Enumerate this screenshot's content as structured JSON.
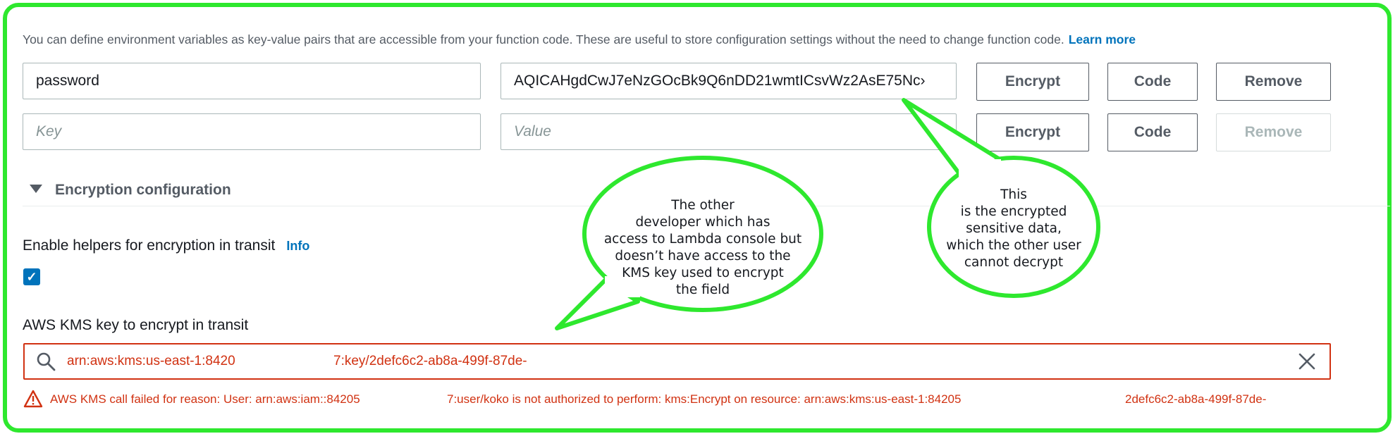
{
  "intro": {
    "text": "You can define environment variables as key-value pairs that are accessible from your function code. These are useful to store configuration settings without the need to change function code.",
    "learn_more": "Learn more"
  },
  "env_rows": [
    {
      "key": "password",
      "value": "AQICAHgdCwJ7eNzGOcBk9Q6nDD21wmtICsvWz2AsE75Nc›",
      "encrypt": "Encrypt",
      "code": "Code",
      "remove": "Remove"
    },
    {
      "key_placeholder": "Key",
      "value_placeholder": "Value",
      "encrypt": "Encrypt",
      "code": "Code",
      "remove": "Remove"
    }
  ],
  "encryption_config": {
    "title": "Encryption configuration",
    "helpers_label": "Enable helpers for encryption in transit",
    "info": "Info",
    "helpers_checked": true,
    "kms_label": "AWS KMS key to encrypt in transit",
    "kms_value_part1": "arn:aws:kms:us-east-1:8420",
    "kms_value_part2": "7:key/2defc6c2-ab8a-499f-87de-",
    "error_part1": "AWS KMS call failed for reason: User: arn:aws:iam::84205",
    "error_part2": "7:user/koko is not authorized to perform: kms:Encrypt on resource: arn:aws:kms:us-east-1:84205",
    "error_part3": "2defc6c2-ab8a-499f-87de-"
  },
  "callouts": {
    "left": [
      "The other",
      "developer which has",
      "access to Lambda console but",
      "doesn’t have access to the",
      "KMS key used to encrypt",
      "the field"
    ],
    "right": [
      "This",
      "is the encrypted",
      "sensitive data,",
      "which the other user",
      "cannot decrypt"
    ]
  },
  "colors": {
    "frame": "#2ee82e",
    "error": "#d13212",
    "link": "#0073bb"
  }
}
